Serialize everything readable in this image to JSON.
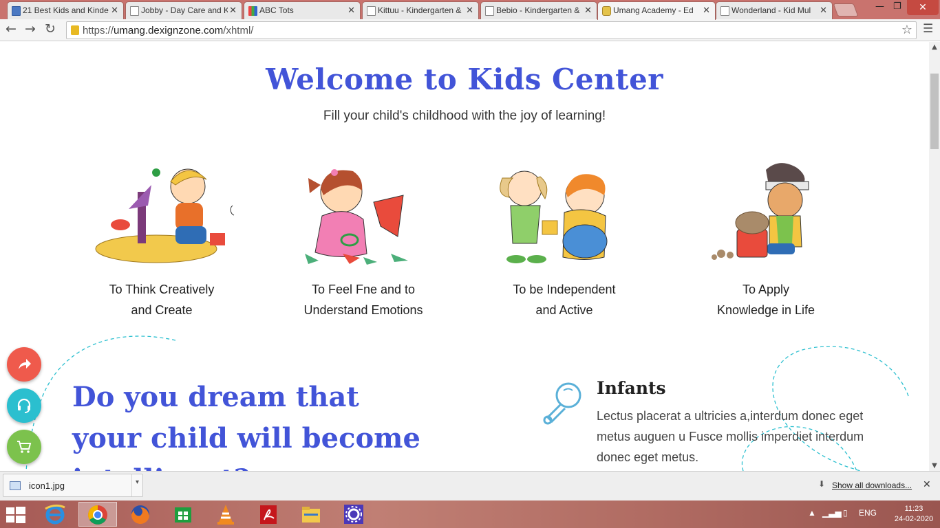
{
  "browser": {
    "tabs": [
      {
        "title": "21 Best Kids and Kinde",
        "favicon": "document-icon"
      },
      {
        "title": "Jobby - Day Care and K",
        "favicon": "document-icon"
      },
      {
        "title": "ABC Tots",
        "favicon": "abc-icon"
      },
      {
        "title": "Kittuu - Kindergarten &",
        "favicon": "document-icon"
      },
      {
        "title": "Bebio - Kindergarten &",
        "favicon": "document-icon"
      },
      {
        "title": "Umang Academy - Ed",
        "favicon": "smiley-icon",
        "active": true
      },
      {
        "title": "Wonderland - Kid Mul",
        "favicon": "document-icon"
      }
    ],
    "tab_close_glyph": "✕",
    "window_controls": {
      "minimize": "—",
      "restore": "❐",
      "close": "✕"
    },
    "url_scheme": "https://",
    "url_host": "umang.dexignzone.com",
    "url_path": "/xhtml/"
  },
  "page": {
    "welcome_title": "Welcome to Kids Center",
    "welcome_subtitle": "Fill your child's childhood with the joy of learning!",
    "features": [
      {
        "line1": "To Think Creatively",
        "line2": "and Create"
      },
      {
        "line1": "To Feel Fne and to",
        "line2": "Understand Emotions"
      },
      {
        "line1": "To be Independent",
        "line2": "and Active"
      },
      {
        "line1": "To Apply",
        "line2": "Knowledge in Life"
      }
    ],
    "dream_line1": "Do you dream that",
    "dream_line2": "your child will become",
    "dream_line3": "intelligent?",
    "infants_title": "Infants",
    "infants_text": "Lectus placerat a ultricies a,interdum donec eget metus auguen u Fusce mollis imperdiet interdum donec eget metus.",
    "colors": {
      "accent_blue": "#4254d8",
      "share": "#ef5a4c",
      "support": "#2bbfcf",
      "cart": "#7cc24d"
    }
  },
  "downloads": {
    "file_name": "icon1.jpg",
    "show_all": "Show all downloads...",
    "close_glyph": "✕"
  },
  "taskbar": {
    "apps": [
      "ie-icon",
      "chrome-icon",
      "firefox-icon",
      "store-icon",
      "vlc-icon",
      "acrobat-icon",
      "explorer-icon",
      "settings-icon"
    ],
    "language": "ENG",
    "time": "11:23",
    "date": "24-02-2020"
  }
}
